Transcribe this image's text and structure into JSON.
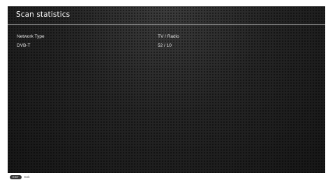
{
  "header": {
    "title": "Scan statistics"
  },
  "table": {
    "rows": [
      {
        "name": "Network Type",
        "value": "TV / Radio"
      },
      {
        "name": "DVB-T",
        "value": "52 / 10"
      }
    ]
  },
  "footer": {
    "exit_key": "EXIT",
    "exit_label": "Exit"
  },
  "colors": {
    "background": "#1e1e1e",
    "divider": "#a8a8a8",
    "text": "#e6e6e6"
  }
}
